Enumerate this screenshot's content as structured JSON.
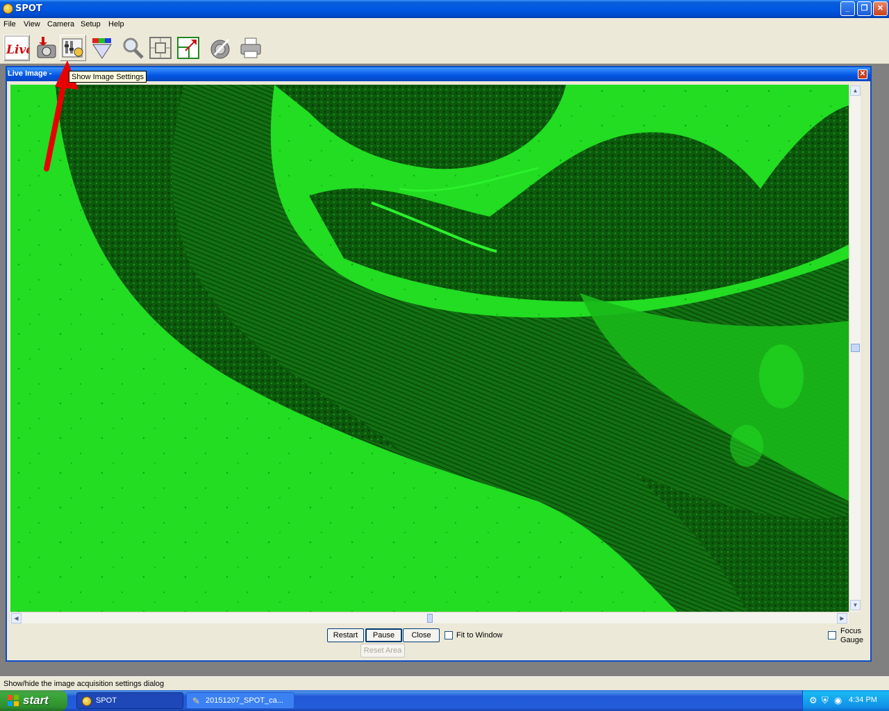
{
  "window": {
    "title": "SPOT"
  },
  "menu": [
    "File",
    "View",
    "Camera",
    "Setup",
    "Help"
  ],
  "toolbar": {
    "icons": [
      "live-icon",
      "camera-icon",
      "image-settings-icon",
      "color-icon",
      "zoom-icon",
      "fit-icon",
      "resize-icon",
      "calibrate-icon",
      "print-icon"
    ],
    "live_label": "Live"
  },
  "tooltip": "Show Image Settings",
  "child_window": {
    "title": "Live Image -"
  },
  "controls": {
    "restart": "Restart",
    "pause": "Pause",
    "close": "Close",
    "fit_to_window": "Fit to Window",
    "reset_area": "Reset Area",
    "focus": "Focus",
    "gauge": "Gauge"
  },
  "status_bar": "Show/hide the image acquisition settings dialog",
  "taskbar": {
    "start": "start",
    "tasks": [
      "SPOT",
      "20151207_SPOT_ca..."
    ],
    "clock": "4:34 PM"
  },
  "colors": {
    "image_green": "#22dd22",
    "tissue_dark": "#0c5a0c",
    "arrow_red": "#e80000"
  }
}
